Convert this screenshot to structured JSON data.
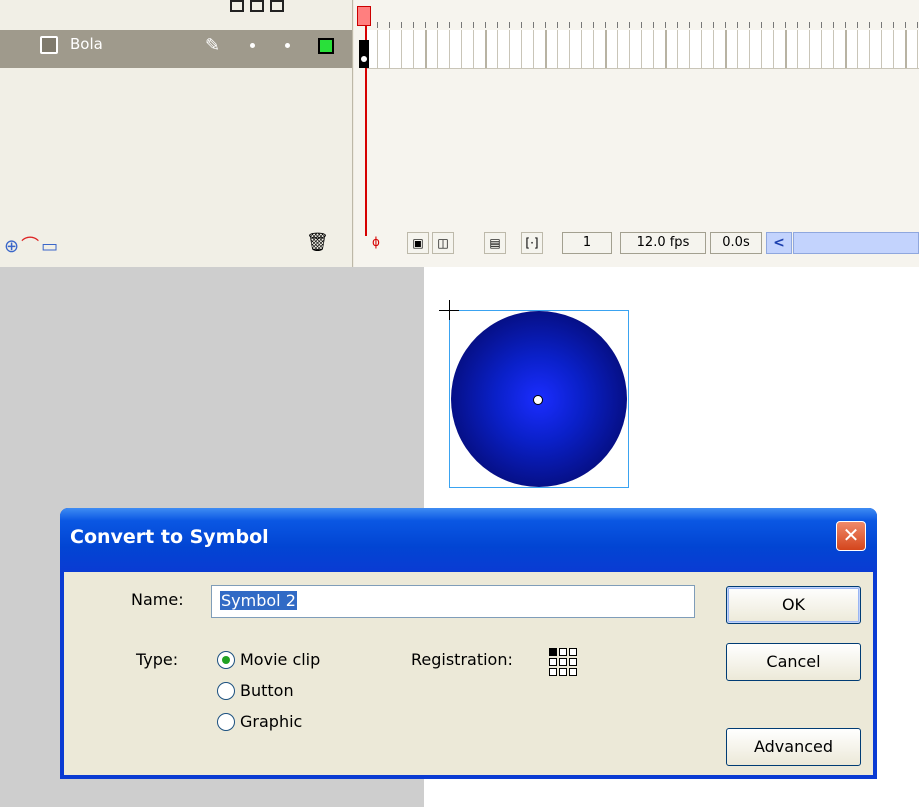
{
  "timeline": {
    "layer_name": "Bola",
    "current_frame": "1",
    "frame_rate": "12.0 fps",
    "elapsed_time": "0.0s",
    "layer_outline_color": "#29e03a",
    "playhead_color": "#d60000"
  },
  "dialog": {
    "title": "Convert to Symbol",
    "name_label": "Name:",
    "name_value": "Symbol 2",
    "type_label": "Type:",
    "type_options": [
      {
        "label": "Movie clip",
        "checked": true
      },
      {
        "label": "Button",
        "checked": false
      },
      {
        "label": "Graphic",
        "checked": false
      }
    ],
    "registration_label": "Registration:",
    "buttons": {
      "ok": "OK",
      "cancel": "Cancel",
      "advanced": "Advanced"
    }
  },
  "icons": {
    "close": "close-icon",
    "trash": "trash-icon",
    "add_layer": "add-layer-icon",
    "add_guide": "add-motion-guide-icon",
    "add_folder": "add-folder-icon",
    "pencil": "pencil-icon"
  },
  "colors": {
    "title_bar": "#0a3bd3",
    "dialog_body": "#ece9d8",
    "ball_center": "#1b2dff",
    "ball_edge": "#000430",
    "stage_bg": "#cecece"
  }
}
